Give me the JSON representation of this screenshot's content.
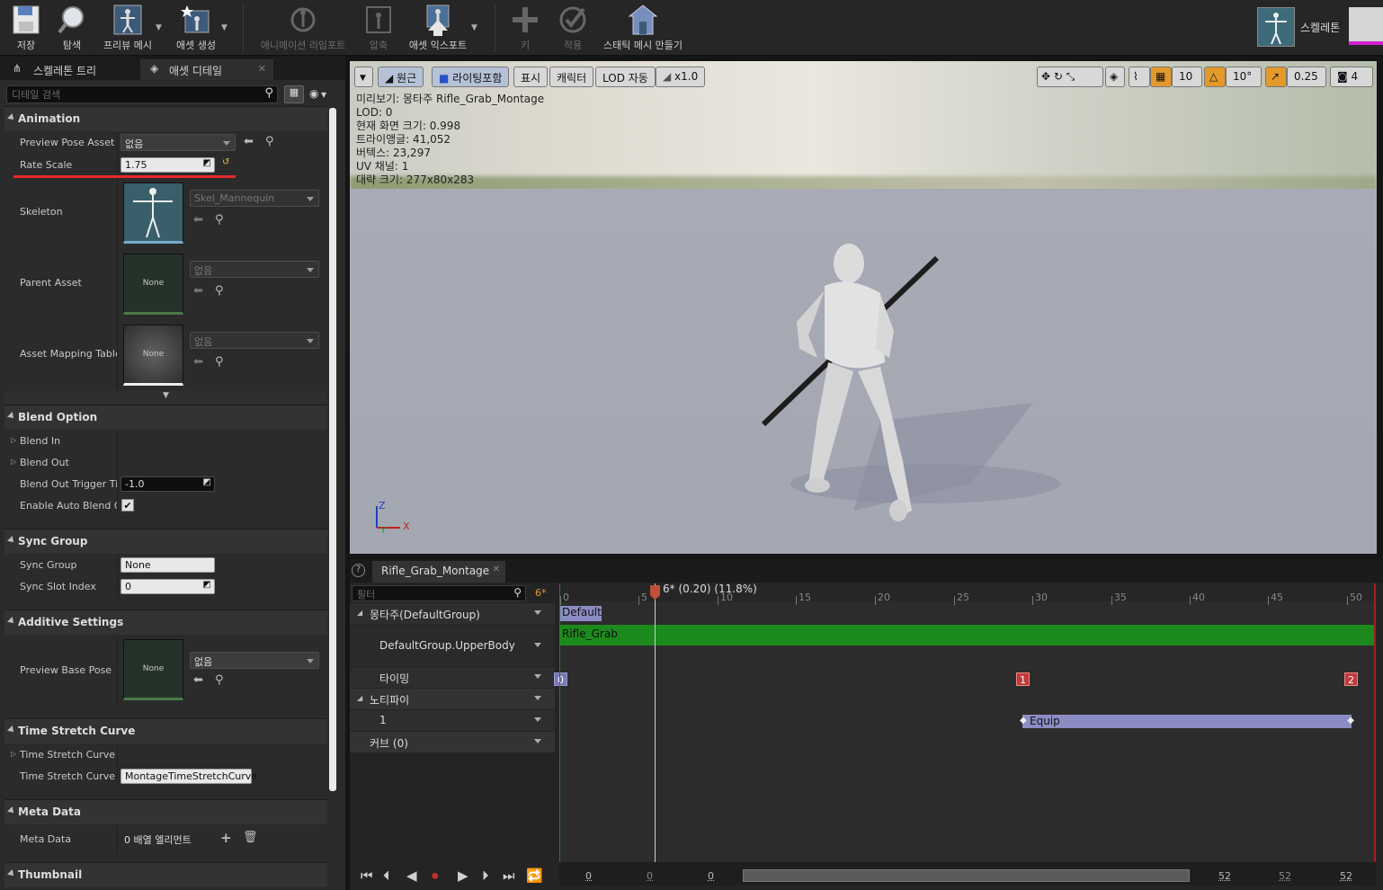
{
  "toolbar": {
    "items": [
      {
        "label": "저장",
        "icon": "save-icon"
      },
      {
        "label": "탐색",
        "icon": "browse-icon"
      },
      {
        "label": "프리뷰 메시",
        "icon": "preview-mesh-icon"
      },
      {
        "label": "애셋 생성",
        "icon": "create-asset-icon"
      },
      {
        "label": "애니메이션 리임포트",
        "icon": "reimport-icon"
      },
      {
        "label": "압축",
        "icon": "compress-icon"
      },
      {
        "label": "애셋 익스포트",
        "icon": "export-icon"
      },
      {
        "label": "키",
        "icon": "key-icon"
      },
      {
        "label": "적용",
        "icon": "apply-icon"
      },
      {
        "label": "스태틱 메시 만들기",
        "icon": "make-static-mesh-icon"
      }
    ],
    "mode_label": "스켈레톤"
  },
  "left_tabs": [
    "스켈레톤 트리",
    "애셋 디테일"
  ],
  "details_search_placeholder": "디테일 검색",
  "categories": {
    "animation": "Animation",
    "blend_option": "Blend Option",
    "sync_group": "Sync Group",
    "additive": "Additive Settings",
    "time_stretch": "Time Stretch Curve",
    "meta_data": "Meta Data",
    "thumbnail": "Thumbnail"
  },
  "props": {
    "preview_pose_asset": {
      "name": "Preview Pose Asset",
      "value": "없음"
    },
    "rate_scale": {
      "name": "Rate Scale",
      "value": "1.75"
    },
    "skeleton": {
      "name": "Skeleton",
      "value": "Skel_Mannequin"
    },
    "parent_asset": {
      "name": "Parent Asset",
      "thumb": "None",
      "value": "없음"
    },
    "asset_mapping": {
      "name": "Asset Mapping Table",
      "thumb": "None",
      "value": "없음"
    },
    "blend_in": {
      "name": "Blend In"
    },
    "blend_out": {
      "name": "Blend Out"
    },
    "blend_out_trigger": {
      "name": "Blend Out Trigger Tim",
      "value": "-1.0"
    },
    "auto_blend_out": {
      "name": "Enable Auto Blend Ou",
      "checked": true
    },
    "sync_group": {
      "name": "Sync Group",
      "value": "None"
    },
    "sync_slot": {
      "name": "Sync Slot Index",
      "value": "0"
    },
    "preview_base_pose": {
      "name": "Preview Base Pose",
      "thumb": "None",
      "value": "없음"
    },
    "time_stretch_curve": {
      "name": "Time Stretch Curve"
    },
    "time_stretch_curve_name": {
      "name": "Time Stretch Curve N",
      "value": "MontageTimeStretchCurve"
    },
    "meta_data": {
      "name": "Meta Data",
      "value": "0 배열 엘리먼트"
    }
  },
  "viewport": {
    "buttons": {
      "perspective": "원근",
      "lighting": "라이팅포함",
      "show": "표시",
      "character": "캐릭터",
      "lod": "LOD 자동",
      "speed": "x1.0"
    },
    "snap": {
      "grid": "10",
      "rotation": "10°",
      "scale": "0.25",
      "camera_speed": "4"
    },
    "overlay_lines": [
      "미리보기: 몽타주 Rifle_Grab_Montage",
      "LOD: 0",
      "현재 화면 크기: 0.998",
      "트라이앵글: 41,052",
      "버텍스: 23,297",
      "UV 채널: 1",
      "대략 크기: 277x80x283"
    ],
    "axis": {
      "z": "Z",
      "x": "X",
      "y": "Y"
    }
  },
  "montage": {
    "tab": "Rifle_Grab_Montage",
    "filter_placeholder": "필터",
    "frame_badge": "6*",
    "playhead": "6* (0.20) (11.8%)",
    "ticks": [
      "0",
      "5",
      "10",
      "15",
      "20",
      "25",
      "30",
      "35",
      "40",
      "45",
      "50"
    ],
    "tracks": [
      {
        "label": "몽타주(DefaultGroup)"
      },
      {
        "label": "DefaultGroup.UpperBody"
      },
      {
        "label": "타이밍"
      },
      {
        "label": "노티파이"
      },
      {
        "label": "1"
      },
      {
        "label": "커브  (0)"
      }
    ],
    "section": "Default",
    "segment": "Rifle_Grab",
    "markers": [
      "0",
      "1",
      "2"
    ],
    "notify": "Equip",
    "footer": {
      "start": "0",
      "view_start": "0",
      "current": "0",
      "view_end": "52",
      "end_a": "52",
      "end_b": "52"
    }
  }
}
